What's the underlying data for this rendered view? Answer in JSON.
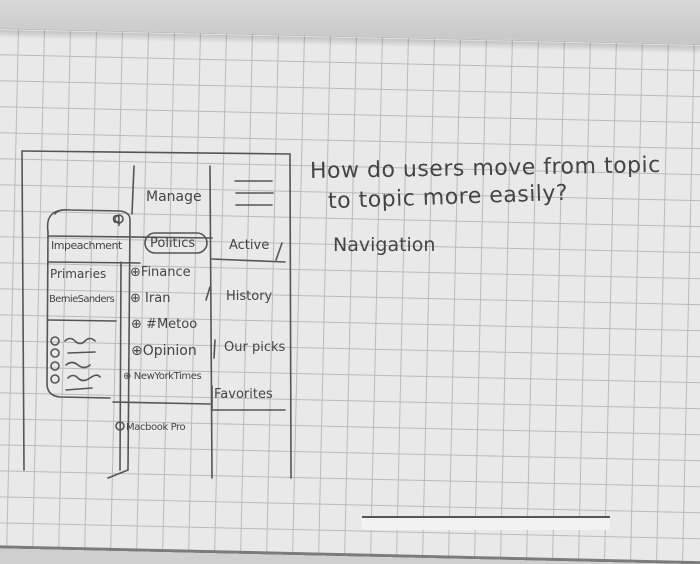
{
  "question": {
    "line1": "How do users move from topic",
    "line2": "to topic more easily?"
  },
  "answer": "Navigation",
  "sketch": {
    "search_icon_glyph": "q",
    "header_manage": "Manage",
    "right_menu": {
      "items": [
        "Active",
        "History",
        "Our picks",
        "Favorites"
      ]
    },
    "topics_left": [
      "Impeachment",
      "Primaries",
      "BernieSanders"
    ],
    "topics_selected": "Politics",
    "topics_mid": [
      "Finance",
      "Iran",
      "#Metoo",
      "Opinion",
      "NewYorkTimes"
    ],
    "footer_item": "Macbook Pro",
    "bullet_symbol": "⊕"
  }
}
